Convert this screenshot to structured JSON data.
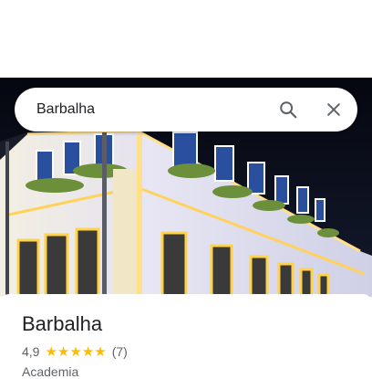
{
  "search": {
    "query": "Barbalha"
  },
  "icons": {
    "search": "search-icon",
    "close": "close-icon",
    "star": "star-icon"
  },
  "hero": {
    "photo": "illuminated colonial building at night"
  },
  "place": {
    "title": "Barbalha",
    "rating": "4,9",
    "stars": 5,
    "review_count": "(7)",
    "category": "Academia"
  },
  "colors": {
    "star": "#fbbc04",
    "text_primary": "#202124",
    "text_secondary": "#5f6368"
  }
}
